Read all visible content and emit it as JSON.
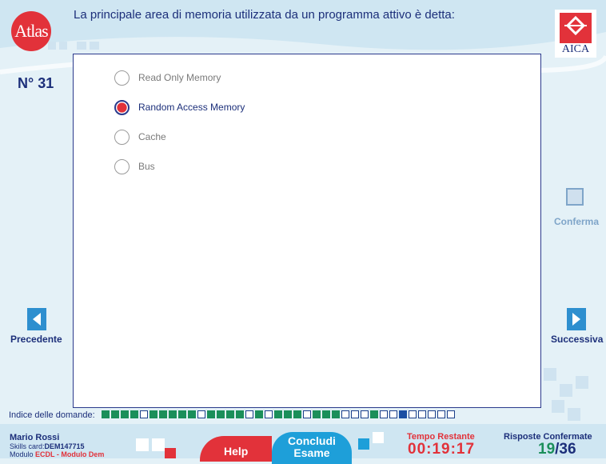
{
  "header": {
    "logo_text": "Atlas",
    "question": "La principale area di memoria utilizzata da un programma attivo è detta:",
    "aica_logo_text": "AICA"
  },
  "question_number": "N° 31",
  "options": [
    {
      "label": "Read Only Memory",
      "selected": false
    },
    {
      "label": "Random Access Memory",
      "selected": true
    },
    {
      "label": "Cache",
      "selected": false
    },
    {
      "label": "Bus",
      "selected": false
    }
  ],
  "confirm_label": "Conferma",
  "nav": {
    "prev_label": "Precedente",
    "next_label": "Successiva"
  },
  "index": {
    "label": "Indice delle domande:",
    "cells": [
      "a",
      "a",
      "a",
      "a",
      "e",
      "a",
      "a",
      "a",
      "a",
      "a",
      "e",
      "a",
      "a",
      "a",
      "a",
      "e",
      "a",
      "e",
      "a",
      "a",
      "a",
      "e",
      "a",
      "a",
      "a",
      "e",
      "e",
      "e",
      "a",
      "e",
      "e",
      "c",
      "e",
      "e",
      "e",
      "e",
      "e"
    ]
  },
  "footer": {
    "name": "Mario Rossi",
    "skills_card_label": "Skills card:",
    "skills_card_value": "DEM147715",
    "module_label": "Modulo",
    "module_value": "ECDL - Modulo Dem",
    "help_label": "Help",
    "concludi_label": "Concludi Esame",
    "time_title": "Tempo Restante",
    "time_value": "00:19:17",
    "answers_title": "Risposte Confermate",
    "answers_done": "19",
    "answers_total": "36"
  },
  "colors": {
    "accent_red": "#e2323a",
    "navy": "#1c2f7a",
    "answered_green": "#1b8f5a",
    "nav_blue": "#2e8fcf"
  }
}
